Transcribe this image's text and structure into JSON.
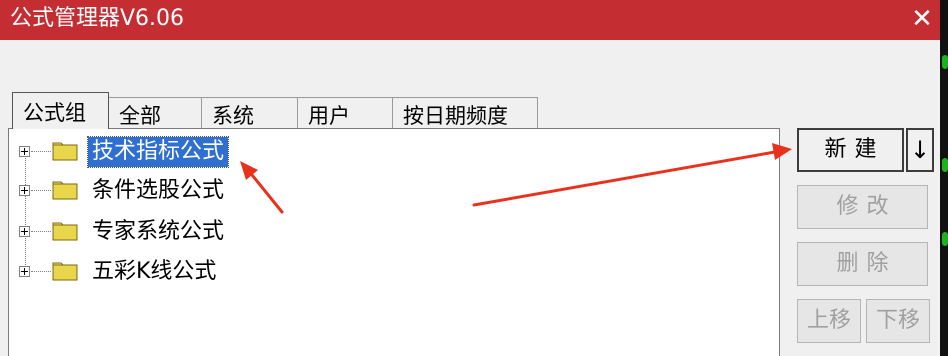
{
  "window": {
    "title": "公式管理器V6.06",
    "close_glyph": "✕"
  },
  "tabs": [
    {
      "label": "公式组",
      "active": true
    },
    {
      "label": "全部",
      "active": false
    },
    {
      "label": "系统",
      "active": false
    },
    {
      "label": "用户",
      "active": false
    },
    {
      "label": "按日期频度",
      "active": false
    }
  ],
  "tree": {
    "items": [
      {
        "label": "技术指标公式",
        "selected": true
      },
      {
        "label": "条件选股公式",
        "selected": false
      },
      {
        "label": "专家系统公式",
        "selected": false
      },
      {
        "label": "五彩K线公式",
        "selected": false
      }
    ]
  },
  "buttons": {
    "new": "新建",
    "down_arrow": "↓",
    "modify": "修改",
    "delete": "删除",
    "move_up": "上移",
    "move_down": "下移"
  },
  "colors": {
    "titlebar": "#c42e33",
    "selection": "#2f6fd0",
    "annotation_arrow": "#e8321e",
    "folder": "#e9d64a"
  },
  "icons": [
    "close-icon",
    "expand-plus-icon",
    "folder-icon",
    "arrow-down-icon"
  ]
}
